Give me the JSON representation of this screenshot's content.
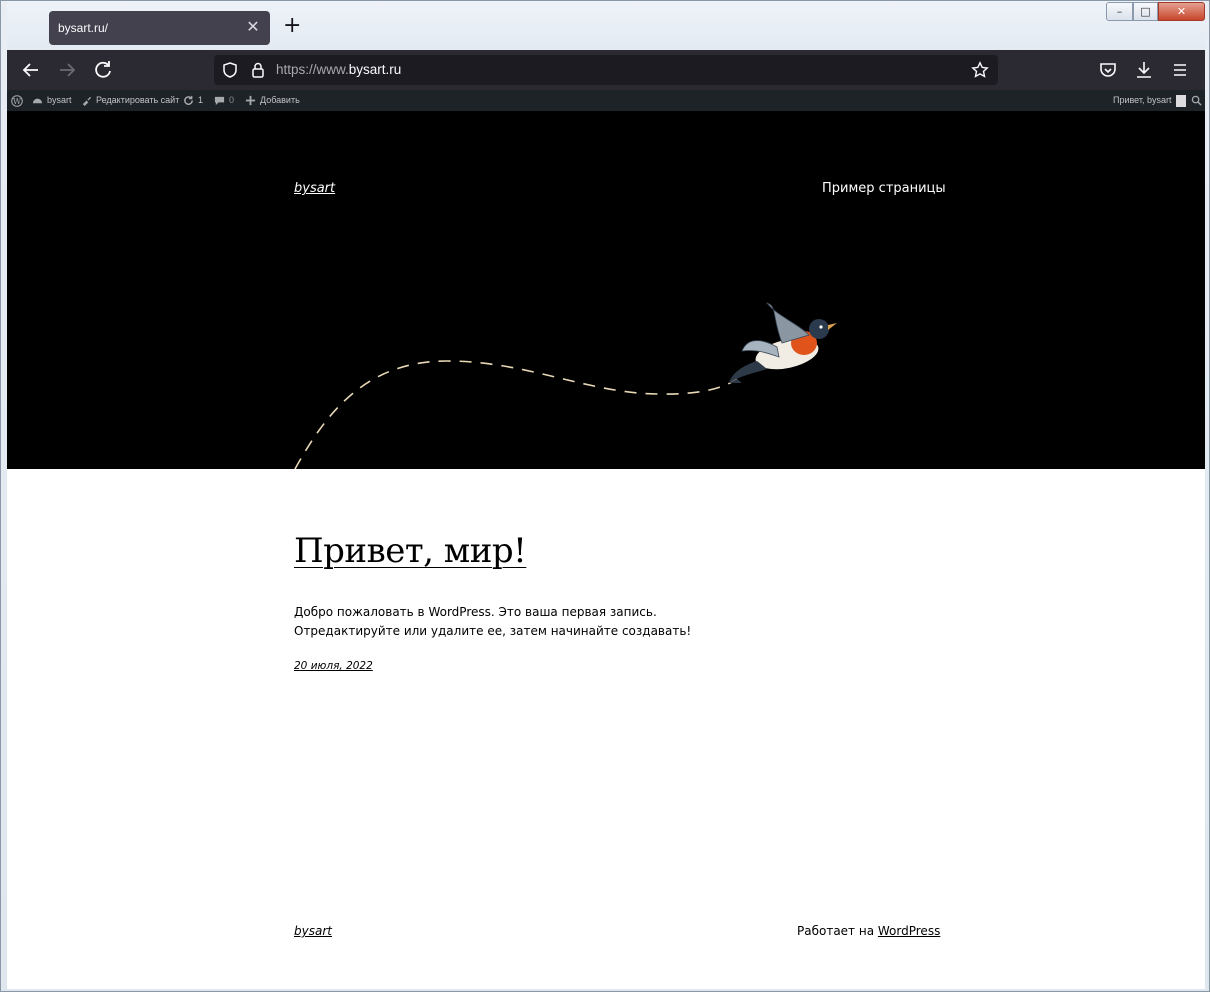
{
  "browser": {
    "tab": {
      "title": "bysart.ru/",
      "close": "✕"
    },
    "new_tab": "+",
    "url": {
      "prefix": "https://www.",
      "domain": "bysart.ru"
    }
  },
  "adminbar": {
    "site": "bysart",
    "customize": "Редактировать сайт",
    "updates_count": "1",
    "comments_count": "0",
    "new": "Добавить",
    "greeting": "Привет, bysart"
  },
  "site": {
    "title": "bysart",
    "nav_link": "Пример страницы"
  },
  "post": {
    "title": "Привет, мир!",
    "excerpt": "Добро пожаловать в WordPress. Это ваша первая запись. Отредактируйте или удалите ее, затем начинайте создавать!",
    "date": "20 июля, 2022"
  },
  "footer": {
    "site_title": "bysart",
    "powered_prefix": "Работает на",
    "powered_link": "WordPress"
  },
  "colors": {
    "tab_bg": "#42414d",
    "toolbar_bg": "#2b2a33",
    "urlbar_bg": "#1c1b22",
    "adminbar_bg": "#1d2327",
    "hero_bg": "#000000"
  }
}
